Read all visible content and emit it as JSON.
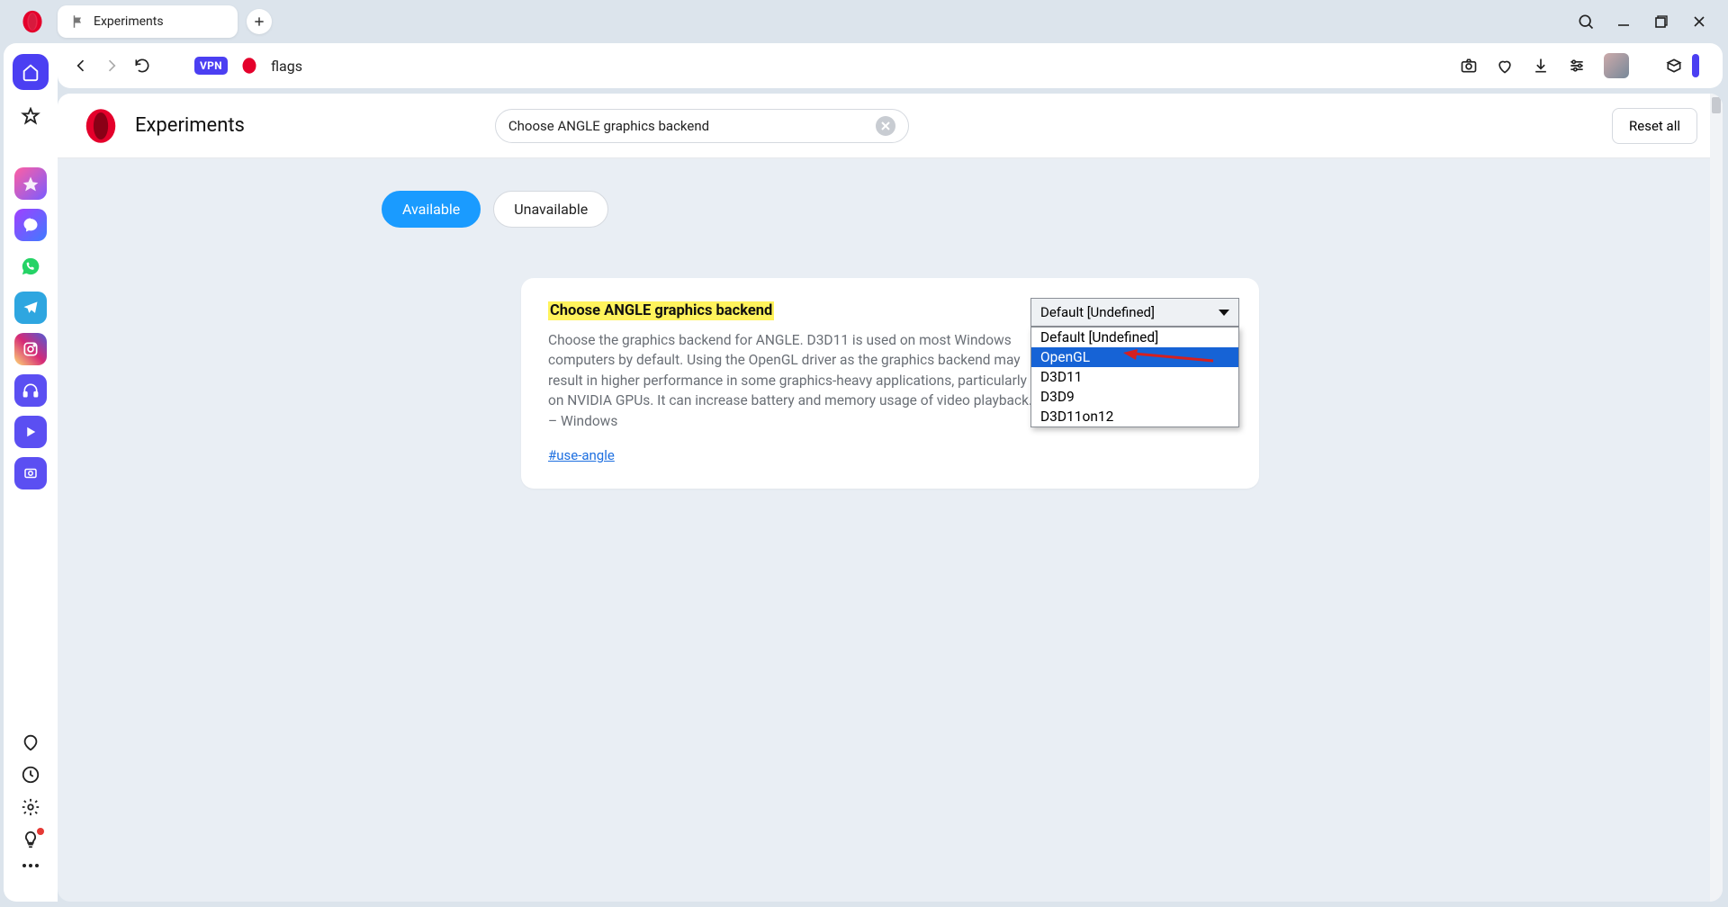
{
  "titlebar": {
    "tab_title": "Experiments"
  },
  "addressbar": {
    "vpn": "VPN",
    "url": "flags"
  },
  "header": {
    "title": "Experiments",
    "search_value": "Choose ANGLE graphics backend",
    "reset": "Reset all"
  },
  "tabs": {
    "available": "Available",
    "unavailable": "Unavailable"
  },
  "flag": {
    "title": "Choose ANGLE graphics backend",
    "description": "Choose the graphics backend for ANGLE. D3D11 is used on most Windows computers by default. Using the OpenGL driver as the graphics backend may result in higher performance in some graphics-heavy applications, particularly on NVIDIA GPUs. It can increase battery and memory usage of video playback. – Windows",
    "link": "#use-angle",
    "selected": "Default [Undefined]",
    "options": [
      "Default [Undefined]",
      "OpenGL",
      "D3D11",
      "D3D9",
      "D3D11on12"
    ],
    "highlight_index": 1
  }
}
